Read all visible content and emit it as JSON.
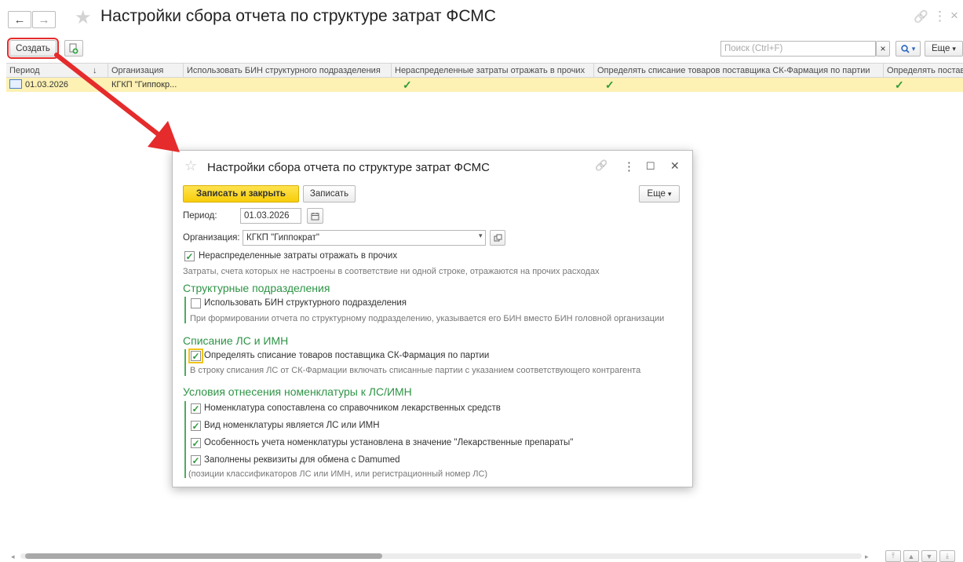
{
  "window": {
    "title": "Настройки сбора отчета по структуре затрат ФСМС",
    "back_glyph": "←",
    "forward_glyph": "→",
    "favorite_glyph": "★",
    "link_glyph": "🔗",
    "menu_glyph": "⋮",
    "close_glyph": "×"
  },
  "toolbar": {
    "create_label": "Создать",
    "search_placeholder": "Поиск (Ctrl+F)",
    "search_clear_glyph": "×",
    "search_glyph": "🔍",
    "dropdown_glyph": "▾",
    "more_label": "Еще"
  },
  "table": {
    "columns": [
      "Период",
      "Организация",
      "Использовать БИН структурного подразделения",
      "Нераспределенные затраты отражать в прочих",
      "Определять списание товаров поставщика СК-Фармация по партии",
      "Определять постав"
    ],
    "sort_glyph": "↓",
    "rows": [
      {
        "period": "01.03.2026",
        "organization": "КГКП \"Гиппокр...",
        "use_bin": "",
        "unallocated": "✓",
        "writeoff_batch": "✓",
        "last": "✓"
      }
    ]
  },
  "dialog": {
    "title": "Настройки сбора отчета по структуре затрат ФСМС",
    "star_glyph": "☆",
    "link_glyph": "🔗",
    "menu_glyph": "⋮",
    "maximize_glyph": "☐",
    "close_glyph": "✕",
    "save_close_label": "Записать и закрыть",
    "save_label": "Записать",
    "more_label": "Еще",
    "period_label": "Период:",
    "period_value": "01.03.2026",
    "org_label": "Организация:",
    "org_value": "КГКП \"Гиппократ\"",
    "unallocated_label": "Нераспределенные затраты отражать в прочих",
    "unallocated_hint": "Затраты, счета которых не настроены в соответствие ни одной строке, отражаются на прочих расходах",
    "section_struct": "Структурные подразделения",
    "use_bin_label": "Использовать БИН структурного подразделения",
    "use_bin_hint": "При формировании отчета по структурному подразделению, указывается его БИН вместо БИН головной организации",
    "section_writeoff": "Списание ЛС и ИМН",
    "writeoff_label": "Определять списание товаров поставщика СК-Фармация по партии",
    "writeoff_hint": "В строку списания ЛС от СК-Фармации включать списанные партии с указанием соответствующего контрагента",
    "section_conditions": "Условия отнесения номенклатуры к ЛС/ИМН",
    "cond1": "Номенклатура сопоставлена со справочником лекарственных средств",
    "cond2": "Вид номенклатуры является ЛС или ИМН",
    "cond3": "Особенность учета номенклатуры установлена в значение \"Лекарственные препараты\"",
    "cond4": "Заполнены реквизиты для обмена с Damumed",
    "cond4_hint": "(позиции классификаторов ЛС или ИМН, или регистрационный номер ЛС)",
    "check_glyph": "✓"
  },
  "colors": {
    "accent_red": "#e52b2b",
    "section_green": "#2e9446",
    "check_green": "#2f9a3d",
    "selected_row": "#fdf1b3",
    "primary_button": "#f7cd0a"
  }
}
